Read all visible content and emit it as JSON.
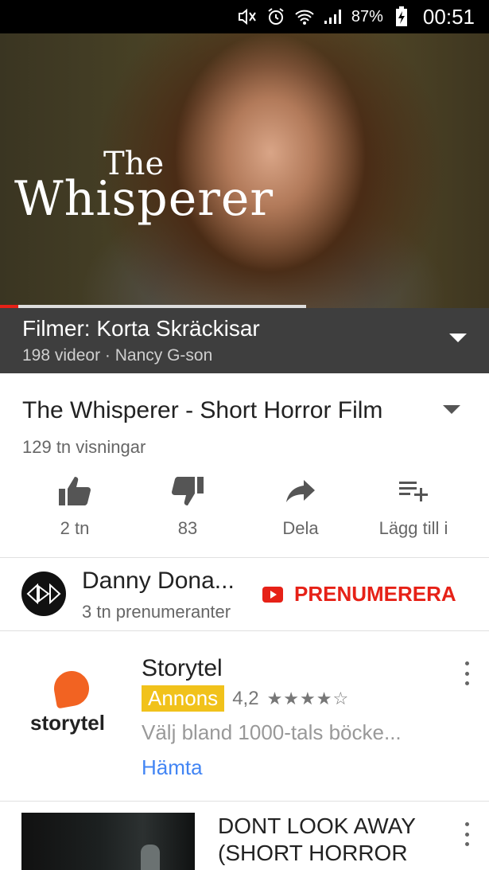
{
  "status_bar": {
    "battery_percent": "87%",
    "time": "00:51",
    "icons": [
      "mute-icon",
      "alarm-icon",
      "wifi-icon",
      "signal-icon",
      "battery-charging-icon"
    ]
  },
  "video": {
    "title_overlay_small": "The",
    "title_overlay_large": "Whisperer",
    "progress_fraction": 0.06
  },
  "playlist": {
    "title": "Filmer: Korta Skräckisar",
    "subtitle": "198 videor · Nancy G-son"
  },
  "info": {
    "title": "The Whisperer - Short Horror Film",
    "views": "129 tn visningar",
    "actions": [
      {
        "name": "like",
        "label": "2 tn"
      },
      {
        "name": "dislike",
        "label": "83"
      },
      {
        "name": "share",
        "label": "Dela"
      },
      {
        "name": "add-to",
        "label": "Lägg till i"
      }
    ]
  },
  "channel": {
    "name": "Danny Dona...",
    "subscribers": "3 tn prenumeranter",
    "subscribe_label": "PRENUMERERA"
  },
  "ad": {
    "logo_text": "storytel",
    "title": "Storytel",
    "badge": "Annons",
    "rating": "4,2",
    "stars": "★★★★☆",
    "description": "Välj bland 1000-tals böcke...",
    "cta": "Hämta"
  },
  "next_video": {
    "title": "DONT LOOK AWAY (SHORT HORROR FI..."
  },
  "colors": {
    "accent_red": "#e62117",
    "badge_yellow": "#f1c21b",
    "link_blue": "#4285f4",
    "playlist_bg": "#3e3e3e"
  }
}
